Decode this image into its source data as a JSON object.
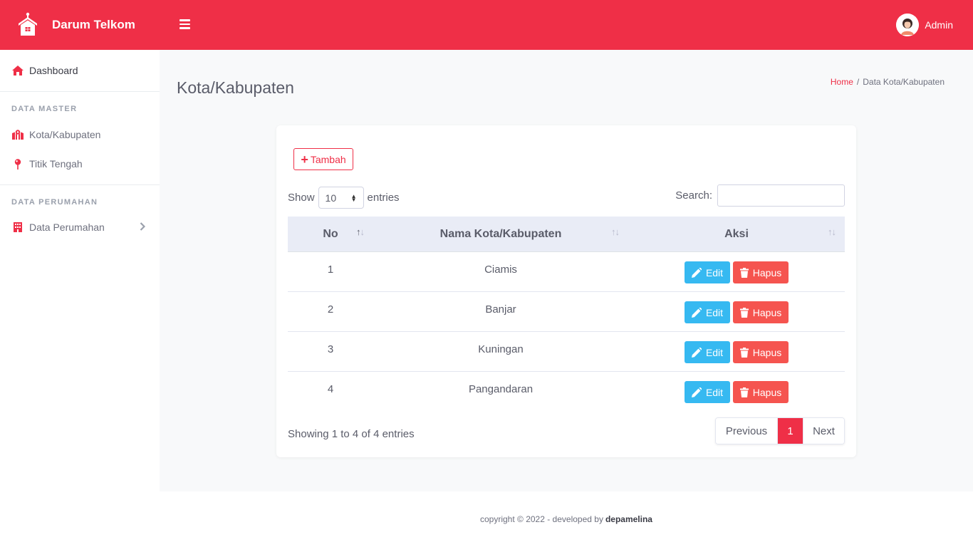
{
  "app": {
    "brand": "Darum Telkom",
    "user_name": "Admin"
  },
  "colors": {
    "primary": "#ef2f47",
    "edit": "#36b9f1",
    "delete": "#f5544f"
  },
  "sidebar": {
    "dashboard": "Dashboard",
    "heading_master": "DATA MASTER",
    "items_master": [
      {
        "label": "Kota/Kabupaten",
        "icon": "map-icon"
      },
      {
        "label": "Titik Tengah",
        "icon": "map-pin-icon"
      }
    ],
    "heading_perumahan": "DATA PERUMAHAN",
    "perumahan": {
      "label": "Data Perumahan",
      "icon": "building-icon"
    }
  },
  "page": {
    "title": "Kota/Kabupaten"
  },
  "breadcrumb": {
    "home": "Home",
    "sep": "/",
    "current": "Data Kota/Kabupaten"
  },
  "toolbar": {
    "add_label": "Tambah"
  },
  "table_controls": {
    "show_label": "Show",
    "entries_label": "entries",
    "page_length": "10",
    "search_label": "Search:"
  },
  "table": {
    "columns": [
      "No",
      "Nama Kota/Kabupaten",
      "Aksi"
    ],
    "rows": [
      {
        "no": "1",
        "nama": "Ciamis"
      },
      {
        "no": "2",
        "nama": "Banjar"
      },
      {
        "no": "3",
        "nama": "Kuningan"
      },
      {
        "no": "4",
        "nama": "Pangandaran"
      }
    ],
    "edit_label": "Edit",
    "delete_label": "Hapus"
  },
  "pagination": {
    "info": "Showing 1 to 4 of 4 entries",
    "previous": "Previous",
    "current": "1",
    "next": "Next"
  },
  "footer": {
    "text": "copyright © 2022 - developed by",
    "author": "depamelina"
  }
}
